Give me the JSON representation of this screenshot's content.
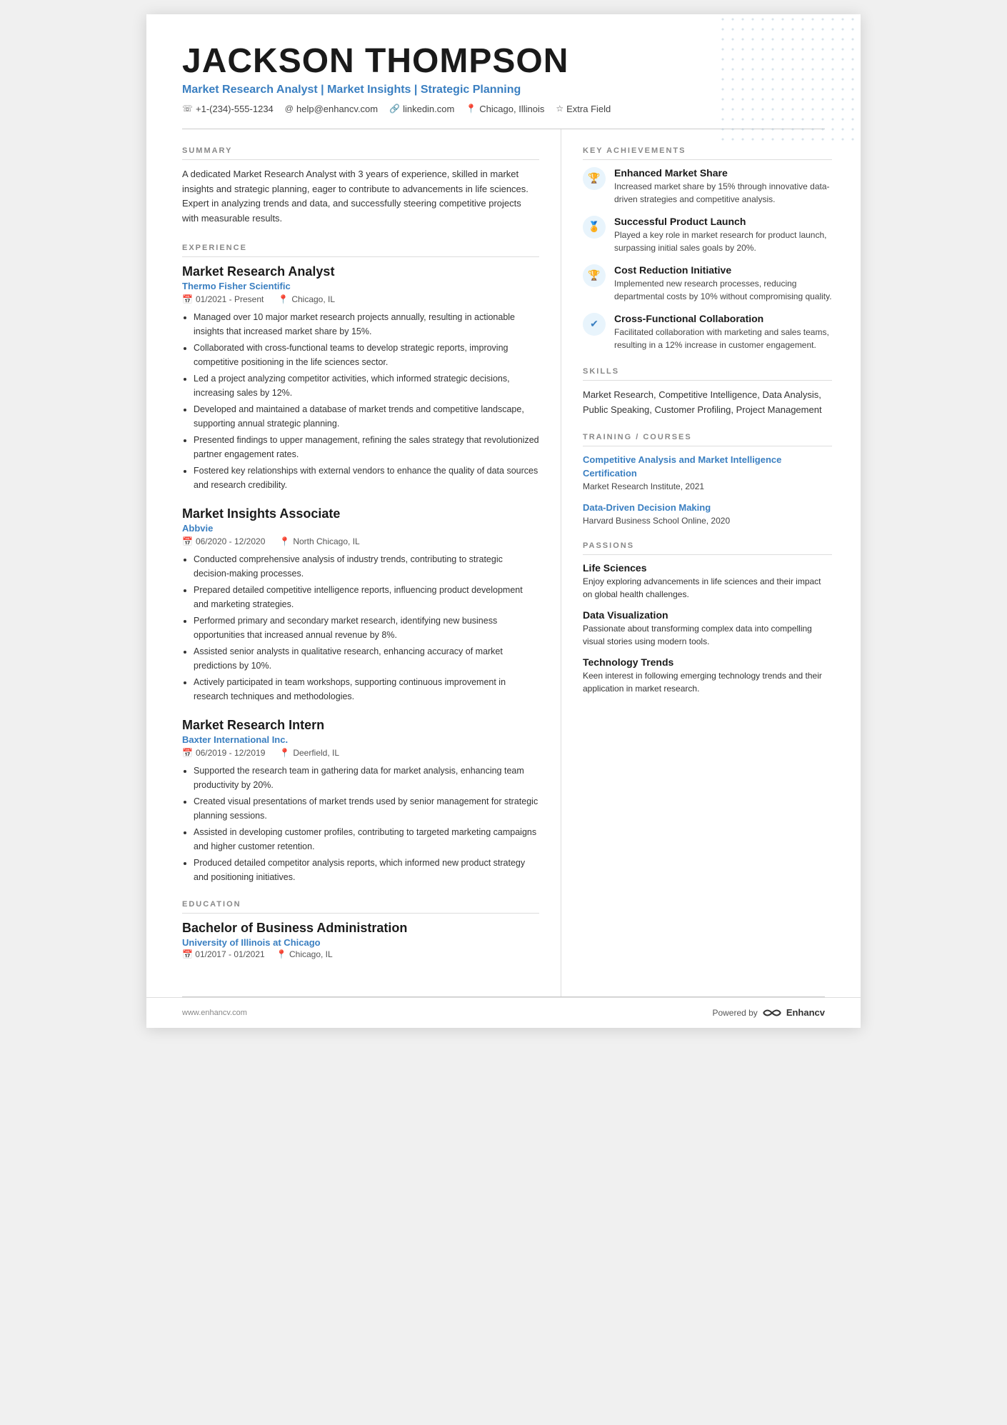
{
  "header": {
    "name": "JACKSON THOMPSON",
    "subtitle": "Market Research Analyst | Market Insights | Strategic Planning",
    "contact": {
      "phone": "+1-(234)-555-1234",
      "email": "help@enhancv.com",
      "linkedin": "linkedin.com",
      "location": "Chicago, Illinois",
      "extra": "Extra Field"
    }
  },
  "summary": {
    "label": "SUMMARY",
    "text": "A dedicated Market Research Analyst with 3 years of experience, skilled in market insights and strategic planning, eager to contribute to advancements in life sciences. Expert in analyzing trends and data, and successfully steering competitive projects with measurable results."
  },
  "experience": {
    "label": "EXPERIENCE",
    "jobs": [
      {
        "title": "Market Research Analyst",
        "company": "Thermo Fisher Scientific",
        "date": "01/2021 - Present",
        "location": "Chicago, IL",
        "bullets": [
          "Managed over 10 major market research projects annually, resulting in actionable insights that increased market share by 15%.",
          "Collaborated with cross-functional teams to develop strategic reports, improving competitive positioning in the life sciences sector.",
          "Led a project analyzing competitor activities, which informed strategic decisions, increasing sales by 12%.",
          "Developed and maintained a database of market trends and competitive landscape, supporting annual strategic planning.",
          "Presented findings to upper management, refining the sales strategy that revolutionized partner engagement rates.",
          "Fostered key relationships with external vendors to enhance the quality of data sources and research credibility."
        ]
      },
      {
        "title": "Market Insights Associate",
        "company": "Abbvie",
        "date": "06/2020 - 12/2020",
        "location": "North Chicago, IL",
        "bullets": [
          "Conducted comprehensive analysis of industry trends, contributing to strategic decision-making processes.",
          "Prepared detailed competitive intelligence reports, influencing product development and marketing strategies.",
          "Performed primary and secondary market research, identifying new business opportunities that increased annual revenue by 8%.",
          "Assisted senior analysts in qualitative research, enhancing accuracy of market predictions by 10%.",
          "Actively participated in team workshops, supporting continuous improvement in research techniques and methodologies."
        ]
      },
      {
        "title": "Market Research Intern",
        "company": "Baxter International Inc.",
        "date": "06/2019 - 12/2019",
        "location": "Deerfield, IL",
        "bullets": [
          "Supported the research team in gathering data for market analysis, enhancing team productivity by 20%.",
          "Created visual presentations of market trends used by senior management for strategic planning sessions.",
          "Assisted in developing customer profiles, contributing to targeted marketing campaigns and higher customer retention.",
          "Produced detailed competitor analysis reports, which informed new product strategy and positioning initiatives."
        ]
      }
    ]
  },
  "education": {
    "label": "EDUCATION",
    "degree": "Bachelor of Business Administration",
    "school": "University of Illinois at Chicago",
    "date": "01/2017 - 01/2021",
    "location": "Chicago, IL"
  },
  "achievements": {
    "label": "KEY ACHIEVEMENTS",
    "items": [
      {
        "icon": "🏆",
        "icon_type": "trophy",
        "title": "Enhanced Market Share",
        "desc": "Increased market share by 15% through innovative data-driven strategies and competitive analysis."
      },
      {
        "icon": "🏅",
        "icon_type": "badge",
        "title": "Successful Product Launch",
        "desc": "Played a key role in market research for product launch, surpassing initial sales goals by 20%."
      },
      {
        "icon": "🏆",
        "icon_type": "trophy",
        "title": "Cost Reduction Initiative",
        "desc": "Implemented new research processes, reducing departmental costs by 10% without compromising quality."
      },
      {
        "icon": "✔",
        "icon_type": "check",
        "title": "Cross-Functional Collaboration",
        "desc": "Facilitated collaboration with marketing and sales teams, resulting in a 12% increase in customer engagement."
      }
    ]
  },
  "skills": {
    "label": "SKILLS",
    "text": "Market Research, Competitive Intelligence, Data Analysis, Public Speaking, Customer Profiling, Project Management"
  },
  "training": {
    "label": "TRAINING / COURSES",
    "items": [
      {
        "title": "Competitive Analysis and Market Intelligence Certification",
        "sub": "Market Research Institute, 2021"
      },
      {
        "title": "Data-Driven Decision Making",
        "sub": "Harvard Business School Online, 2020"
      }
    ]
  },
  "passions": {
    "label": "PASSIONS",
    "items": [
      {
        "title": "Life Sciences",
        "desc": "Enjoy exploring advancements in life sciences and their impact on global health challenges."
      },
      {
        "title": "Data Visualization",
        "desc": "Passionate about transforming complex data into compelling visual stories using modern tools."
      },
      {
        "title": "Technology Trends",
        "desc": "Keen interest in following emerging technology trends and their application in market research."
      }
    ]
  },
  "footer": {
    "url": "www.enhancv.com",
    "powered_by": "Powered by",
    "brand": "Enhancv"
  }
}
